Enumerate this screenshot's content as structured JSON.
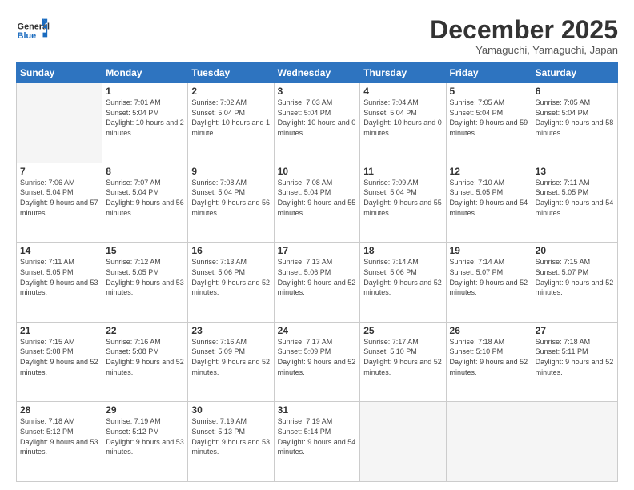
{
  "header": {
    "logo_general": "General",
    "logo_blue": "Blue",
    "month_title": "December 2025",
    "subtitle": "Yamaguchi, Yamaguchi, Japan"
  },
  "weekdays": [
    "Sunday",
    "Monday",
    "Tuesday",
    "Wednesday",
    "Thursday",
    "Friday",
    "Saturday"
  ],
  "weeks": [
    [
      {
        "day": "",
        "info": ""
      },
      {
        "day": "1",
        "info": "Sunrise: 7:01 AM\nSunset: 5:04 PM\nDaylight: 10 hours\nand 2 minutes."
      },
      {
        "day": "2",
        "info": "Sunrise: 7:02 AM\nSunset: 5:04 PM\nDaylight: 10 hours\nand 1 minute."
      },
      {
        "day": "3",
        "info": "Sunrise: 7:03 AM\nSunset: 5:04 PM\nDaylight: 10 hours\nand 0 minutes."
      },
      {
        "day": "4",
        "info": "Sunrise: 7:04 AM\nSunset: 5:04 PM\nDaylight: 10 hours\nand 0 minutes."
      },
      {
        "day": "5",
        "info": "Sunrise: 7:05 AM\nSunset: 5:04 PM\nDaylight: 9 hours\nand 59 minutes."
      },
      {
        "day": "6",
        "info": "Sunrise: 7:05 AM\nSunset: 5:04 PM\nDaylight: 9 hours\nand 58 minutes."
      }
    ],
    [
      {
        "day": "7",
        "info": "Sunrise: 7:06 AM\nSunset: 5:04 PM\nDaylight: 9 hours\nand 57 minutes."
      },
      {
        "day": "8",
        "info": "Sunrise: 7:07 AM\nSunset: 5:04 PM\nDaylight: 9 hours\nand 56 minutes."
      },
      {
        "day": "9",
        "info": "Sunrise: 7:08 AM\nSunset: 5:04 PM\nDaylight: 9 hours\nand 56 minutes."
      },
      {
        "day": "10",
        "info": "Sunrise: 7:08 AM\nSunset: 5:04 PM\nDaylight: 9 hours\nand 55 minutes."
      },
      {
        "day": "11",
        "info": "Sunrise: 7:09 AM\nSunset: 5:04 PM\nDaylight: 9 hours\nand 55 minutes."
      },
      {
        "day": "12",
        "info": "Sunrise: 7:10 AM\nSunset: 5:05 PM\nDaylight: 9 hours\nand 54 minutes."
      },
      {
        "day": "13",
        "info": "Sunrise: 7:11 AM\nSunset: 5:05 PM\nDaylight: 9 hours\nand 54 minutes."
      }
    ],
    [
      {
        "day": "14",
        "info": "Sunrise: 7:11 AM\nSunset: 5:05 PM\nDaylight: 9 hours\nand 53 minutes."
      },
      {
        "day": "15",
        "info": "Sunrise: 7:12 AM\nSunset: 5:05 PM\nDaylight: 9 hours\nand 53 minutes."
      },
      {
        "day": "16",
        "info": "Sunrise: 7:13 AM\nSunset: 5:06 PM\nDaylight: 9 hours\nand 52 minutes."
      },
      {
        "day": "17",
        "info": "Sunrise: 7:13 AM\nSunset: 5:06 PM\nDaylight: 9 hours\nand 52 minutes."
      },
      {
        "day": "18",
        "info": "Sunrise: 7:14 AM\nSunset: 5:06 PM\nDaylight: 9 hours\nand 52 minutes."
      },
      {
        "day": "19",
        "info": "Sunrise: 7:14 AM\nSunset: 5:07 PM\nDaylight: 9 hours\nand 52 minutes."
      },
      {
        "day": "20",
        "info": "Sunrise: 7:15 AM\nSunset: 5:07 PM\nDaylight: 9 hours\nand 52 minutes."
      }
    ],
    [
      {
        "day": "21",
        "info": "Sunrise: 7:15 AM\nSunset: 5:08 PM\nDaylight: 9 hours\nand 52 minutes."
      },
      {
        "day": "22",
        "info": "Sunrise: 7:16 AM\nSunset: 5:08 PM\nDaylight: 9 hours\nand 52 minutes."
      },
      {
        "day": "23",
        "info": "Sunrise: 7:16 AM\nSunset: 5:09 PM\nDaylight: 9 hours\nand 52 minutes."
      },
      {
        "day": "24",
        "info": "Sunrise: 7:17 AM\nSunset: 5:09 PM\nDaylight: 9 hours\nand 52 minutes."
      },
      {
        "day": "25",
        "info": "Sunrise: 7:17 AM\nSunset: 5:10 PM\nDaylight: 9 hours\nand 52 minutes."
      },
      {
        "day": "26",
        "info": "Sunrise: 7:18 AM\nSunset: 5:10 PM\nDaylight: 9 hours\nand 52 minutes."
      },
      {
        "day": "27",
        "info": "Sunrise: 7:18 AM\nSunset: 5:11 PM\nDaylight: 9 hours\nand 52 minutes."
      }
    ],
    [
      {
        "day": "28",
        "info": "Sunrise: 7:18 AM\nSunset: 5:12 PM\nDaylight: 9 hours\nand 53 minutes."
      },
      {
        "day": "29",
        "info": "Sunrise: 7:19 AM\nSunset: 5:12 PM\nDaylight: 9 hours\nand 53 minutes."
      },
      {
        "day": "30",
        "info": "Sunrise: 7:19 AM\nSunset: 5:13 PM\nDaylight: 9 hours\nand 53 minutes."
      },
      {
        "day": "31",
        "info": "Sunrise: 7:19 AM\nSunset: 5:14 PM\nDaylight: 9 hours\nand 54 minutes."
      },
      {
        "day": "",
        "info": ""
      },
      {
        "day": "",
        "info": ""
      },
      {
        "day": "",
        "info": ""
      }
    ]
  ]
}
